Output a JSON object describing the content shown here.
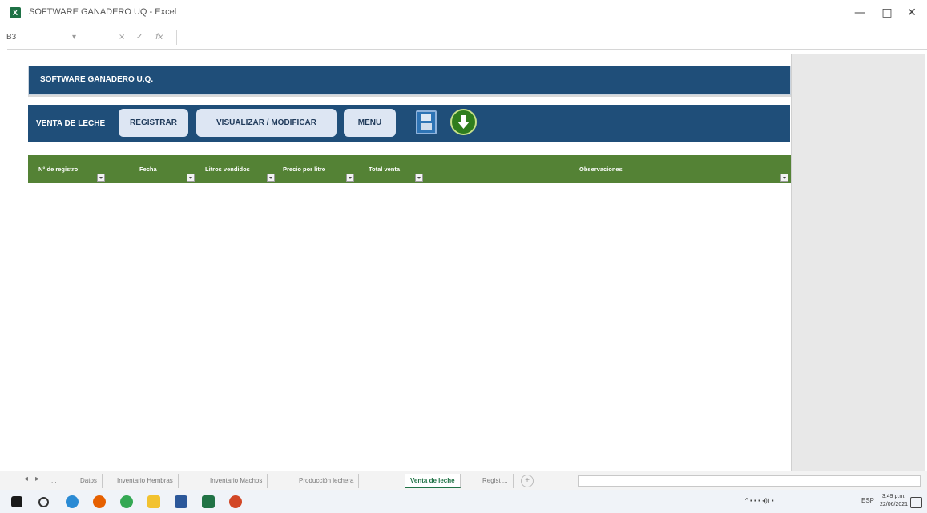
{
  "window": {
    "title": "SOFTWARE GANADERO UQ - Excel",
    "app_icon": "excel-icon",
    "controls": [
      "—",
      "□",
      "✕"
    ]
  },
  "formula_bar": {
    "name_box": "B3",
    "cancel": "×",
    "enter": "✓",
    "fx": "fx",
    "value": ""
  },
  "sheet": {
    "title": "SOFTWARE GANADERO U.Q.",
    "nav": {
      "label": "VENTA DE LECHE",
      "buttons": [
        "REGISTRAR",
        "VISUALIZAR / MODIFICAR",
        "MENU"
      ],
      "save_icon": "save-icon",
      "download_icon": "arrow-down-circle-icon"
    },
    "table": {
      "headers": [
        "N° de registro",
        "Fecha",
        "Litros vendidos",
        "Precio por litro",
        "Total venta",
        "Observaciones"
      ]
    }
  },
  "tabs": {
    "ellipsis": "...",
    "items": [
      "Datos",
      "Inventario Hembras",
      "Inventario Machos",
      "Producción lechera",
      "Venta de leche",
      "Regist ..."
    ],
    "active": "Venta de leche"
  },
  "taskbar": {
    "language": "ESP",
    "time": "3:49 p.m.",
    "date": "22/06/2021"
  },
  "colors": {
    "title_band": "#1f4e79",
    "header_row": "#548235",
    "button_bg": "#dde6f3"
  }
}
